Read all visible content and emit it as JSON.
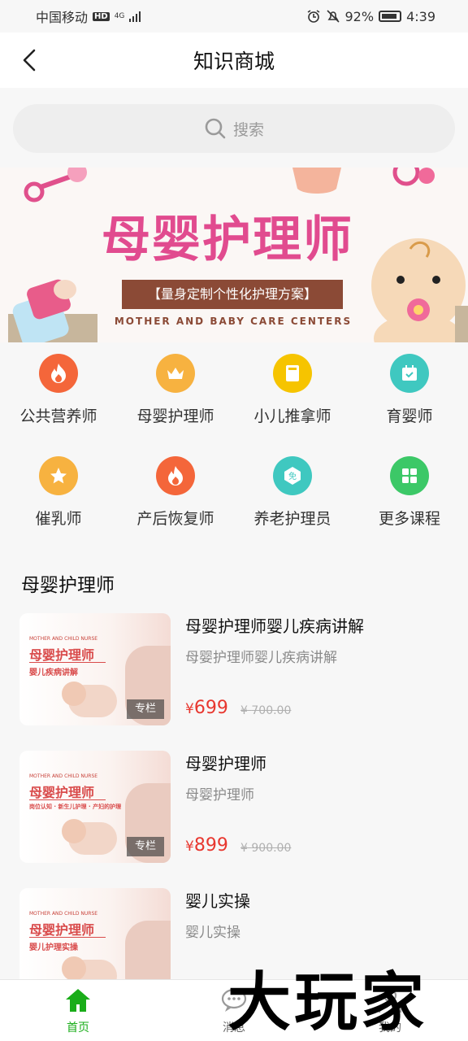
{
  "status": {
    "carrier": "中国移动",
    "hd": "HD",
    "net": "4G",
    "battery": "92%",
    "time": "4:39"
  },
  "nav": {
    "title": "知识商城"
  },
  "search": {
    "placeholder": "搜索"
  },
  "banner": {
    "title": "母婴护理师",
    "ribbon": "【量身定制个性化护理方案】",
    "subtitle": "MOTHER AND BABY CARE CENTERS"
  },
  "categories": [
    {
      "label": "公共营养师",
      "icon": "flame-icon",
      "color": "#f4663a"
    },
    {
      "label": "母婴护理师",
      "icon": "crown-icon",
      "color": "#f7b240"
    },
    {
      "label": "小儿推拿师",
      "icon": "book-icon",
      "color": "#f6c400"
    },
    {
      "label": "育婴师",
      "icon": "calendar-check-icon",
      "color": "#3fc8c0"
    },
    {
      "label": "催乳师",
      "icon": "star-icon",
      "color": "#f7b240"
    },
    {
      "label": "产后恢复师",
      "icon": "flame-icon",
      "color": "#f4663a"
    },
    {
      "label": "养老护理员",
      "icon": "free-hexagon-icon",
      "color": "#3fc8c0"
    },
    {
      "label": "更多课程",
      "icon": "grid-icon",
      "color": "#3cc867"
    }
  ],
  "free_badge": "免",
  "section": {
    "title": "母婴护理师"
  },
  "courses": [
    {
      "title": "母婴护理师婴儿疾病讲解",
      "subtitle": "母婴护理师婴儿疾病讲解",
      "price": "699",
      "old_price": "700.00",
      "tag": "专栏",
      "thumb_en": "MOTHER AND CHILD NURSE",
      "thumb_t1": "母婴护理师",
      "thumb_t2": "婴儿疾病讲解"
    },
    {
      "title": "母婴护理师",
      "subtitle": "母婴护理师",
      "price": "899",
      "old_price": "900.00",
      "tag": "专栏",
      "thumb_en": "MOTHER AND CHILD NURSE",
      "thumb_t1": "母婴护理师",
      "thumb_t2": "岗位认知 · 新生儿护理 · 产妇的护理"
    },
    {
      "title": "婴儿实操",
      "subtitle": "婴儿实操",
      "price": "",
      "old_price": "",
      "tag": "",
      "thumb_en": "MOTHER AND CHILD NURSE",
      "thumb_t1": "母婴护理师",
      "thumb_t2": "婴儿护理实操"
    }
  ],
  "currency": "¥",
  "tabs": [
    {
      "label": "首页",
      "icon": "home-icon",
      "active": true
    },
    {
      "label": "消息",
      "icon": "chat-icon",
      "active": false
    },
    {
      "label": "我的",
      "icon": "user-icon",
      "active": false
    }
  ],
  "watermark": "大玩家",
  "colors": {
    "accent": "#1aad19",
    "price": "#e8372f",
    "banner_pink": "#e14b8f"
  }
}
